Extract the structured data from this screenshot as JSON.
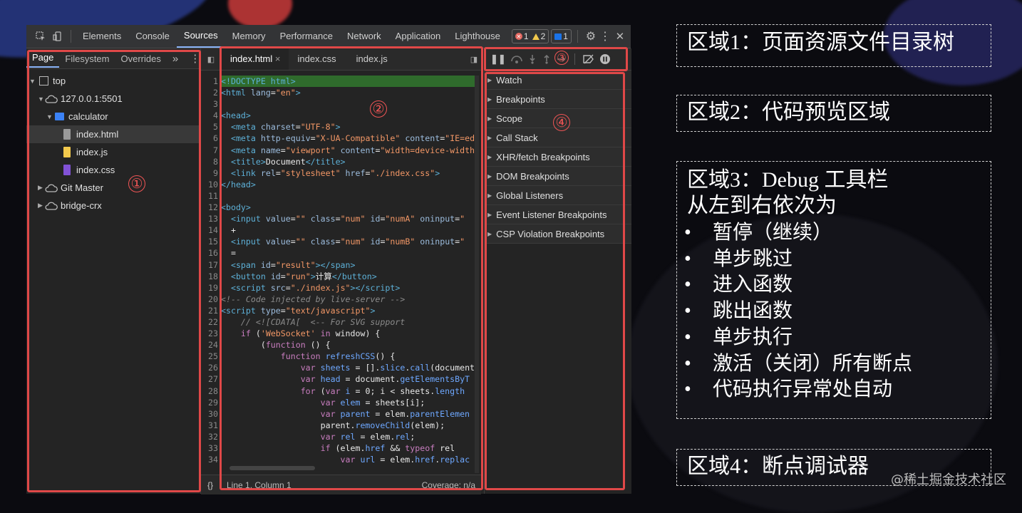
{
  "devtools": {
    "panel_tabs": [
      "Elements",
      "Console",
      "Sources",
      "Memory",
      "Performance",
      "Network",
      "Application",
      "Lighthouse"
    ],
    "active_panel": "Sources",
    "errors": "1",
    "warnings": "2",
    "messages": "1",
    "navigator": {
      "tabs": [
        "Page",
        "Filesystem",
        "Overrides"
      ],
      "more": "»",
      "tree": [
        {
          "label": "top",
          "depth": 0,
          "type": "frame"
        },
        {
          "label": "127.0.0.1:5501",
          "depth": 1,
          "type": "cloud"
        },
        {
          "label": "calculator",
          "depth": 2,
          "type": "folder"
        },
        {
          "label": "index.html",
          "depth": 3,
          "type": "file-html"
        },
        {
          "label": "index.js",
          "depth": 3,
          "type": "file-js"
        },
        {
          "label": "index.css",
          "depth": 3,
          "type": "file-css"
        },
        {
          "label": "Git Master",
          "depth": 0,
          "type": "cloud"
        },
        {
          "label": "bridge-crx",
          "depth": 0,
          "type": "cloud"
        }
      ]
    },
    "editor": {
      "tabs": [
        "index.html",
        "index.css",
        "index.js"
      ],
      "close": "×",
      "status_left": "Line 1, Column 1",
      "status_right": "Coverage: n/a",
      "braces": "{}",
      "line_numbers": [
        "1",
        "2",
        "3",
        "4",
        "5",
        "6",
        "7",
        "8",
        "9",
        "10",
        "11",
        "12",
        "13",
        "14",
        "15",
        "16",
        "17",
        "18",
        "19",
        "20",
        "21",
        "22",
        "23",
        "24",
        "25",
        "26",
        "27",
        "28",
        "29",
        "30",
        "31",
        "32",
        "33",
        "34"
      ]
    },
    "debugger_panes": [
      "Watch",
      "Breakpoints",
      "Scope",
      "Call Stack",
      "XHR/fetch Breakpoints",
      "DOM Breakpoints",
      "Global Listeners",
      "Event Listener Breakpoints",
      "CSP Violation Breakpoints"
    ]
  },
  "annotations": {
    "area1_marker": "①",
    "area2_marker": "②",
    "area3_marker": "③",
    "area4_marker": "④",
    "color": "#e04848"
  },
  "notes": {
    "area1": "区域1：页面资源文件目录树",
    "area2": "区域2：代码预览区域",
    "area3_title": "区域3：Debug  工具栏",
    "area3_sub": "从左到右依次为",
    "area3_items": [
      "暂停（继续）",
      "单步跳过",
      "进入函数",
      "跳出函数",
      "单步执行",
      "激活（关闭）所有断点",
      "代码执行异常处自动"
    ],
    "area4": "区域4：断点调试器"
  },
  "watermark": "@稀土掘金技术社区"
}
